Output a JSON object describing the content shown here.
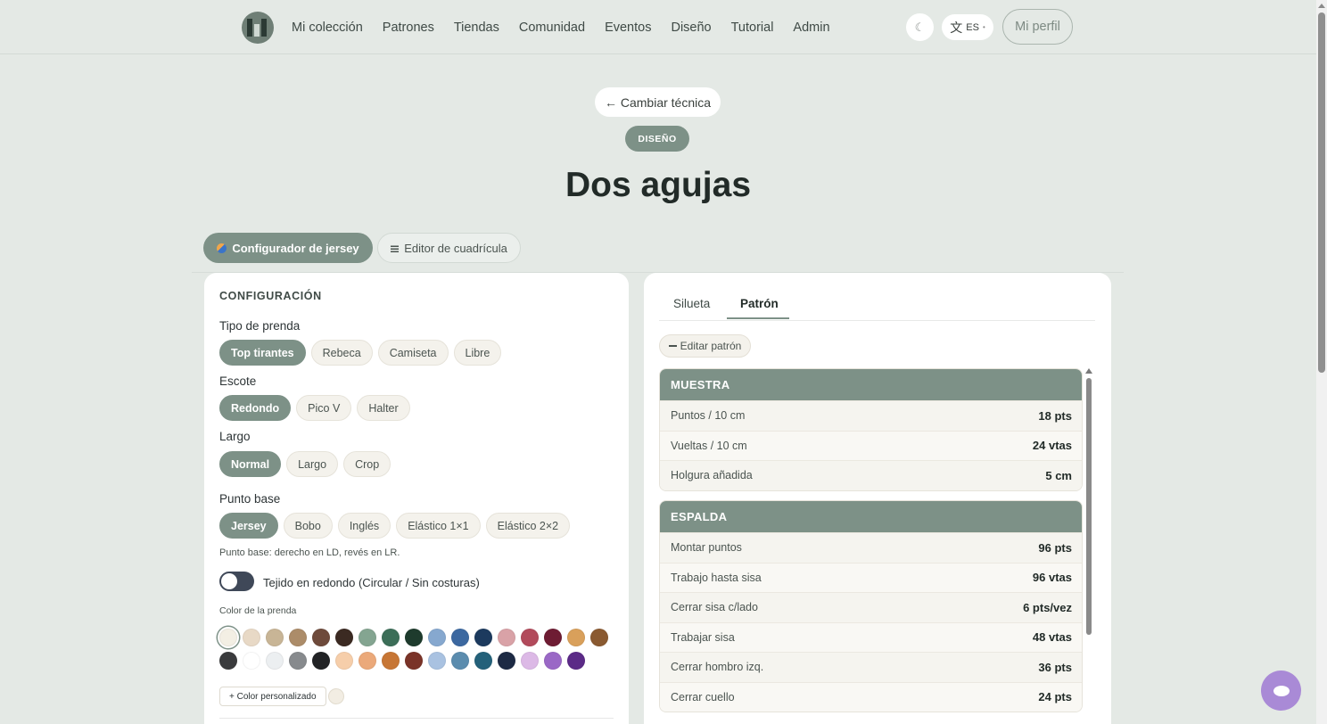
{
  "nav": {
    "links": [
      "Mi colección",
      "Patrones",
      "Tiendas",
      "Comunidad",
      "Eventos",
      "Diseño",
      "Tutorial",
      "Admin"
    ],
    "theme_icon": "☾",
    "lang_glyph": "文",
    "lang_code": "ES",
    "profile_label": "Mi perfil"
  },
  "hero": {
    "back_label": "← Cambiar técnica",
    "badge": "DISEÑO",
    "title": "Dos agujas"
  },
  "mode_tabs": {
    "jersey": "Configurador de jersey",
    "grid": "Editor de cuadrícula"
  },
  "config": {
    "title": "CONFIGURACIÓN",
    "garment_label": "Tipo de prenda",
    "garment_options": [
      "Top tirantes",
      "Rebeca",
      "Camiseta",
      "Libre"
    ],
    "neck_label": "Escote",
    "neck_options": [
      "Redondo",
      "Pico V",
      "Halter"
    ],
    "length_label": "Largo",
    "length_options": [
      "Normal",
      "Largo",
      "Crop"
    ],
    "stitch_label": "Punto base",
    "stitch_options": [
      "Jersey",
      "Bobo",
      "Inglés",
      "Elástico 1×1",
      "Elástico 2×2"
    ],
    "stitch_hint": "Punto base: derecho en LD, revés en LR.",
    "toggle_label": "Tejido en redondo (Circular / Sin costuras)",
    "color_label": "Color de la prenda",
    "colors_row1": [
      "#f3efe4",
      "#e8d9c6",
      "#c8b596",
      "#ac8c69",
      "#6e4a3b",
      "#3b2a22",
      "#84a591",
      "#3c6e58",
      "#1e3b2d",
      "#86a8cf",
      "#3c68a0",
      "#1c3a5e",
      "#d9a2a7",
      "#b24a5b",
      "#6e1c33",
      "#d9a05b",
      "#8a5a31"
    ],
    "colors_row2": [
      "#3a3b3d",
      "#ffffff",
      "#eceff1",
      "#878a8d",
      "#222325",
      "#f6ceaa",
      "#eba97a",
      "#c77635",
      "#7a3328",
      "#a9c2e1",
      "#5b8cae",
      "#24617a",
      "#1d2a44",
      "#dcb9e6",
      "#9a68c6",
      "#5b2a87"
    ],
    "custom_color_label": "+ Color personalizado"
  },
  "pattern": {
    "tab_silhouette": "Silueta",
    "tab_pattern": "Patrón",
    "edit_label": "Editar patrón",
    "sections": [
      {
        "title": "MUESTRA",
        "rows": [
          {
            "k": "Puntos / 10 cm",
            "v": "18 pts"
          },
          {
            "k": "Vueltas / 10 cm",
            "v": "24 vtas"
          },
          {
            "k": "Holgura añadida",
            "v": "5 cm"
          }
        ]
      },
      {
        "title": "ESPALDA",
        "rows": [
          {
            "k": "Montar puntos",
            "v": "96 pts"
          },
          {
            "k": "Trabajo hasta sisa",
            "v": "96 vtas"
          },
          {
            "k": "Cerrar sisa c/lado",
            "v": "6 pts/vez"
          },
          {
            "k": "Trabajar sisa",
            "v": "48 vtas"
          },
          {
            "k": "Cerrar hombro izq.",
            "v": "36 pts"
          },
          {
            "k": "Cerrar cuello",
            "v": "24 pts"
          }
        ]
      }
    ]
  }
}
